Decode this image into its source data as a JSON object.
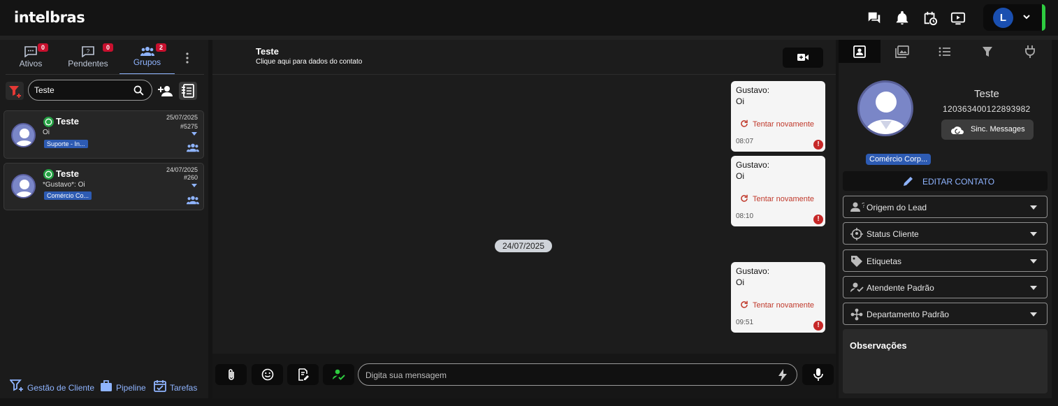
{
  "app": {
    "logo": "intelbras"
  },
  "user": {
    "initial": "L"
  },
  "left_panel": {
    "tabs": [
      {
        "label": "Ativos",
        "badge": "0"
      },
      {
        "label": "Pendentes",
        "badge": "0"
      },
      {
        "label": "Grupos",
        "badge": "2"
      }
    ],
    "search_value": "Teste",
    "conversations": [
      {
        "name": "Teste",
        "preview": "Oi",
        "date": "25/07/2025",
        "number": "#5275",
        "tag": "Suporte - In..."
      },
      {
        "name": "Teste",
        "preview": "*Gustavo*: Oi",
        "date": "24/07/2025",
        "number": "#260",
        "tag": "Comércio Co..."
      }
    ],
    "bottom_links": [
      "Gestão de Cliente",
      "Pipeline",
      "Tarefas"
    ]
  },
  "chat": {
    "contact_name": "Teste",
    "contact_subtitle": "Clique aqui para dados do contato",
    "date_separator": "24/07/2025",
    "messages": [
      {
        "sender": "Gustavo:",
        "text": "Oi",
        "retry": "Tentar novamente",
        "time": "08:07"
      },
      {
        "sender": "Gustavo:",
        "text": "Oi",
        "retry": "Tentar novamente",
        "time": "08:10"
      },
      {
        "sender": "Gustavo:",
        "text": "Oi",
        "retry": "Tentar novamente",
        "time": "09:51"
      }
    ],
    "error_mark": "!",
    "input_placeholder": "Digita sua mensagem"
  },
  "right_panel": {
    "contact_name": "Teste",
    "contact_phone": "120363400122893982",
    "sync_label": "Sinc. Messages",
    "tag": "Comércio Corp...",
    "edit_label": "EDITAR CONTATO",
    "fields": [
      "Origem do Lead",
      "Status Cliente",
      "Etiquetas",
      "Atendente Padrão",
      "Departamento Padrão"
    ],
    "notes_title": "Observações"
  },
  "colors": {
    "accent": "#8fb4ff",
    "badge": "#c8102e",
    "error": "#c0392b",
    "online": "#2ecc40",
    "tag": "#2d5bb3"
  }
}
